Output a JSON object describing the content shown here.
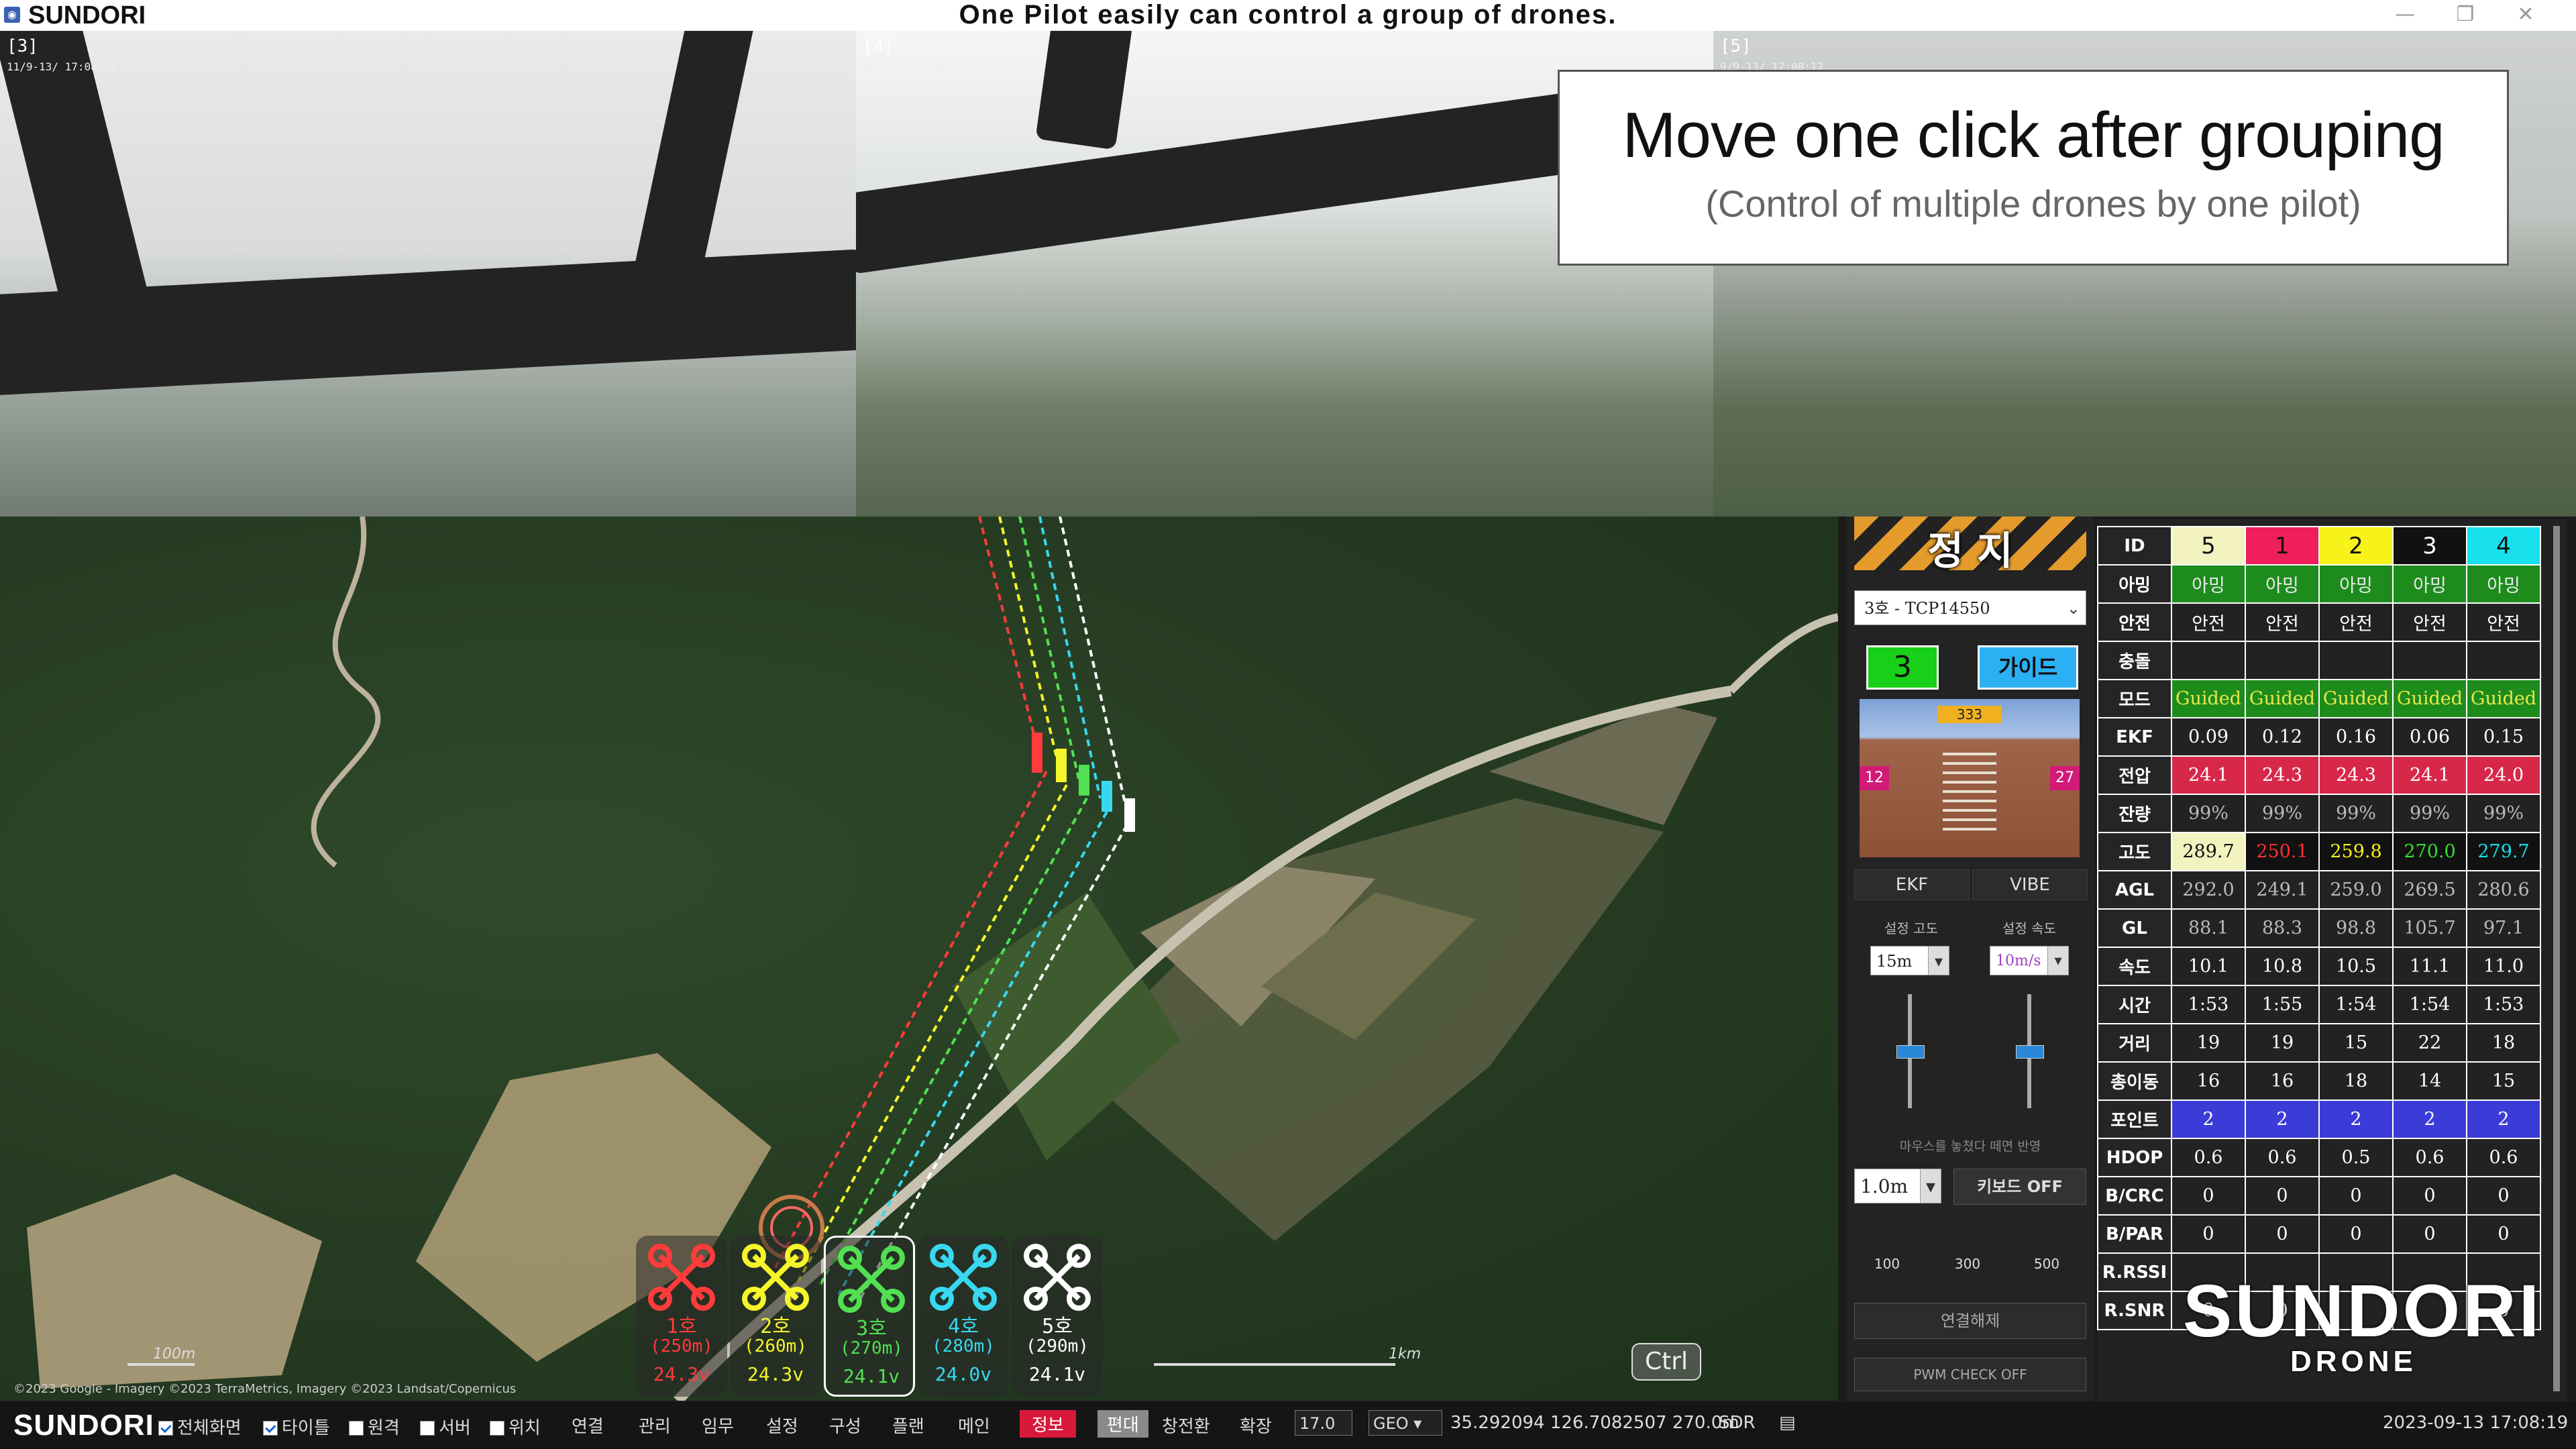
{
  "window": {
    "app_name": "SUNDORI",
    "headline": "One Pilot easily can control a group of drones.",
    "buttons": [
      "—",
      "❐",
      "✕"
    ]
  },
  "videos": [
    {
      "label": "[3]",
      "time": "11/9-13/ 17:08:15"
    },
    {
      "label": "[4]",
      "time": "9/9-13/ 17:08:17"
    },
    {
      "label": "[5]",
      "time": "9/9-13/ 17:08:17"
    }
  ],
  "caption": {
    "title": "Move one click after grouping",
    "subtitle": "(Control of multiple drones by one pilot)"
  },
  "map": {
    "scale_small": "100m",
    "scale_large": "1km",
    "copyright": "©2023 Google - Imagery ©2023 TerraMetrics, Imagery ©2023 Landsat/Copernicus",
    "ctrl_badge": "Ctrl",
    "drones": [
      {
        "name": "1호",
        "alt": "(250m)",
        "volt": "24.3v",
        "color": "#ff3b3b"
      },
      {
        "name": "2호",
        "alt": "(260m)",
        "volt": "24.3v",
        "color": "#f5f52a"
      },
      {
        "name": "3호",
        "alt": "(270m)",
        "volt": "24.1v",
        "color": "#52e052"
      },
      {
        "name": "4호",
        "alt": "(280m)",
        "volt": "24.0v",
        "color": "#38d8f0"
      },
      {
        "name": "5호",
        "alt": "(290m)",
        "volt": "24.1v",
        "color": "#ffffff"
      }
    ]
  },
  "panel": {
    "stop_label": "정 지",
    "drone_select": "3호 - TCP14550",
    "selected_id": "3",
    "guide_label": "가이드",
    "hud_left": "12",
    "hud_right": "27",
    "hud_top": "333",
    "ekf_label": "EKF",
    "vibe_label": "VIBE",
    "alt_set_label": "설정 고도",
    "speed_set_label": "설정 속도",
    "alt_set_value": "15m",
    "speed_set_value": "10m/s",
    "mouse_note": "마우스를 놓쳤다 떼면 반영",
    "step_value": "1.0m",
    "keyboard_label": "키보드 OFF",
    "preset_100": "100",
    "preset_300": "300",
    "preset_500": "500",
    "disconnect_label": "연결해제",
    "pwm_label": "PWM CHECK OFF"
  },
  "telemetry": {
    "header_label": "ID",
    "ids": [
      {
        "id": "5",
        "bg": "#f3f3c0",
        "fg": "#111"
      },
      {
        "id": "1",
        "bg": "#ef1f5c",
        "fg": "#111"
      },
      {
        "id": "2",
        "bg": "#f6f21a",
        "fg": "#111"
      },
      {
        "id": "3",
        "bg": "#111111",
        "fg": "#fff"
      },
      {
        "id": "4",
        "bg": "#18e0ec",
        "fg": "#111"
      }
    ],
    "rows": [
      {
        "label": "아밍",
        "values": [
          "아밍",
          "아밍",
          "아밍",
          "아밍",
          "아밍"
        ],
        "bg": "#1d8c1d",
        "fg": "#eaeaea"
      },
      {
        "label": "안전",
        "values": [
          "안전",
          "안전",
          "안전",
          "안전",
          "안전"
        ],
        "bg": "#222",
        "fg": "#fff"
      },
      {
        "label": "충돌",
        "values": [
          "",
          "",
          "",
          "",
          ""
        ],
        "bg": "#222",
        "fg": "#fff"
      },
      {
        "label": "모드",
        "values": [
          "Guided",
          "Guided",
          "Guided",
          "Guided",
          "Guided"
        ],
        "bg": "#1d8c1d",
        "fg": "#e8e84a"
      },
      {
        "label": "EKF",
        "values": [
          "0.09",
          "0.12",
          "0.16",
          "0.06",
          "0.15"
        ],
        "bg": "#222",
        "fg": "#fff"
      },
      {
        "label": "전압",
        "values": [
          "24.1",
          "24.3",
          "24.3",
          "24.1",
          "24.0"
        ],
        "bg": "#d8284a",
        "fg": "#fff"
      },
      {
        "label": "잔량",
        "values": [
          "99%",
          "99%",
          "99%",
          "99%",
          "99%"
        ],
        "bg": "#222",
        "fg": "#bbb"
      },
      {
        "label": "고도",
        "values": [
          "289.7",
          "250.1",
          "259.8",
          "270.0",
          "279.7"
        ],
        "cell_styles": [
          {
            "bg": "#f3f3c0",
            "fg": "#111"
          },
          {
            "bg": "#111",
            "fg": "#ff3030"
          },
          {
            "bg": "#111",
            "fg": "#f6f21a"
          },
          {
            "bg": "#111",
            "fg": "#33e033"
          },
          {
            "bg": "#111",
            "fg": "#18e0ec"
          }
        ]
      },
      {
        "label": "AGL",
        "values": [
          "292.0",
          "249.1",
          "259.0",
          "269.5",
          "280.6"
        ],
        "bg": "#222",
        "fg": "#bbb"
      },
      {
        "label": "GL",
        "values": [
          "88.1",
          "88.3",
          "98.8",
          "105.7",
          "97.1"
        ],
        "bg": "#222",
        "fg": "#bbb"
      },
      {
        "label": "속도",
        "values": [
          "10.1",
          "10.8",
          "10.5",
          "11.1",
          "11.0"
        ],
        "bg": "#222",
        "fg": "#fff"
      },
      {
        "label": "시간",
        "values": [
          "1:53",
          "1:55",
          "1:54",
          "1:54",
          "1:53"
        ],
        "bg": "#222",
        "fg": "#fff"
      },
      {
        "label": "거리",
        "values": [
          "19",
          "19",
          "15",
          "22",
          "18"
        ],
        "bg": "#222",
        "fg": "#fff"
      },
      {
        "label": "총이동",
        "values": [
          "16",
          "16",
          "18",
          "14",
          "15"
        ],
        "bg": "#222",
        "fg": "#fff"
      },
      {
        "label": "포인트",
        "values": [
          "2",
          "2",
          "2",
          "2",
          "2"
        ],
        "bg": "#3b3bd8",
        "fg": "#fff"
      },
      {
        "label": "HDOP",
        "values": [
          "0.6",
          "0.6",
          "0.5",
          "0.6",
          "0.6"
        ],
        "bg": "#222",
        "fg": "#fff"
      },
      {
        "label": "B/CRC",
        "values": [
          "0",
          "0",
          "0",
          "0",
          "0"
        ],
        "bg": "#222",
        "fg": "#fff"
      },
      {
        "label": "B/PAR",
        "values": [
          "0",
          "0",
          "0",
          "0",
          "0"
        ],
        "bg": "#222",
        "fg": "#fff"
      },
      {
        "label": "R.RSSI",
        "values": [
          "",
          "",
          "",
          "",
          ""
        ],
        "bg": "#222",
        "fg": "#fff"
      },
      {
        "label": "R.SNR",
        "values": [
          "0",
          "0",
          "",
          "",
          "0"
        ],
        "bg": "#222",
        "fg": "#fff"
      }
    ],
    "watermark_top": "SUNDORI",
    "watermark_bottom": "DRONE"
  },
  "statusbar": {
    "logo": "SUNDORI",
    "checks": [
      {
        "label": "전체화면",
        "checked": true
      },
      {
        "label": "타이틀",
        "checked": true
      },
      {
        "label": "원격",
        "checked": false
      },
      {
        "label": "서버",
        "checked": false
      },
      {
        "label": "위치",
        "checked": false
      }
    ],
    "menus": [
      "연결",
      "관리",
      "임무",
      "설정",
      "구성",
      "플랜",
      "메인"
    ],
    "info_tab": "정보",
    "formation_tab": "편대",
    "window_tab": "창전환",
    "zoom_tab": "확장",
    "zoom_value": "17.0",
    "geo_value": "GEO",
    "position": "35.292094  126.7082507  270.0m",
    "sdr_label": "SDR",
    "datetime": "2023-09-13  17:08:19"
  }
}
